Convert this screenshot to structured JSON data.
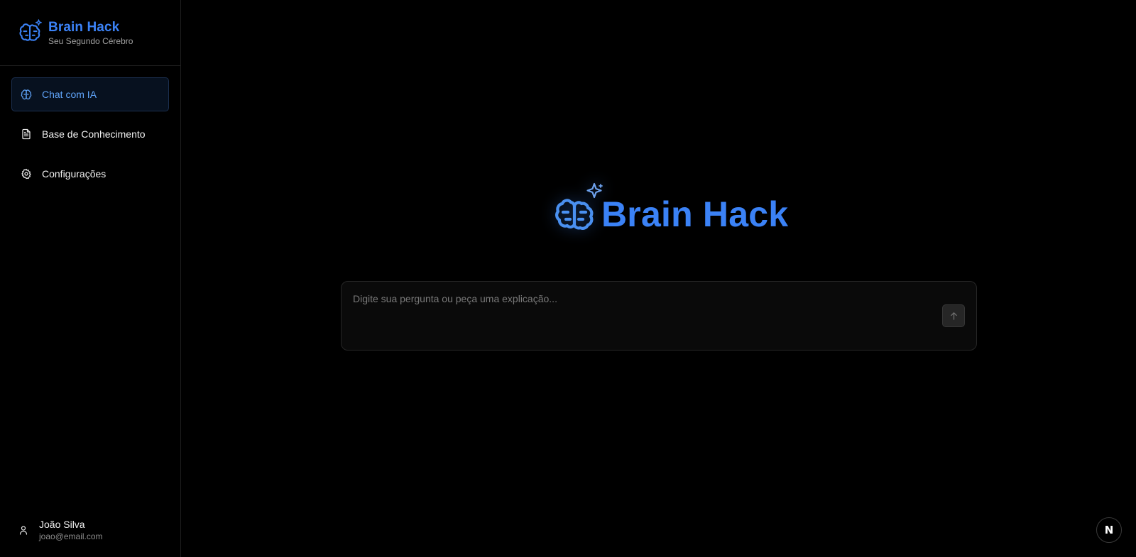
{
  "brand": {
    "title": "Brain Hack",
    "subtitle": "Seu Segundo Cérebro",
    "icon": "brain-sparkles-icon",
    "accent_color": "#3b82f6"
  },
  "nav": {
    "items": [
      {
        "label": "Chat com IA",
        "icon": "brain-icon",
        "active": true
      },
      {
        "label": "Base de Conhecimento",
        "icon": "document-icon",
        "active": false
      },
      {
        "label": "Configurações",
        "icon": "gear-icon",
        "active": false
      }
    ]
  },
  "user": {
    "name": "João Silva",
    "email": "joao@email.com",
    "icon": "user-icon"
  },
  "hero": {
    "title": "Brain Hack",
    "icon": "brain-sparkles-icon"
  },
  "composer": {
    "placeholder": "Digite sua pergunta ou peça uma explicação...",
    "value": "",
    "send_icon": "arrow-up-icon"
  },
  "badge": {
    "label": "N"
  }
}
